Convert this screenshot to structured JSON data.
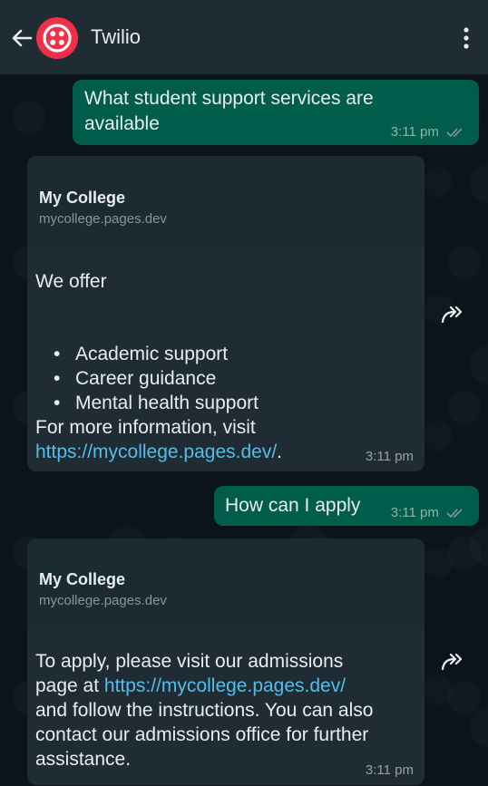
{
  "header": {
    "title": "Twilio",
    "icons": [
      "back-arrow-icon",
      "twilio-logo-icon",
      "more-vert-icon"
    ]
  },
  "messages": [
    {
      "direction": "out",
      "text_line1": "What student support services are",
      "text_line2": "available",
      "time": "3:11 pm"
    },
    {
      "direction": "in",
      "sender": "My College",
      "domain": "mycollege.pages.dev",
      "intro": "We offer",
      "list": [
        "Academic support",
        "Career guidance",
        "Mental health support"
      ],
      "more_info": "For more information, visit",
      "link": "https://mycollege.pages.dev/",
      "link_suffix": ".",
      "time": "3:11 pm"
    },
    {
      "direction": "out",
      "text": "How can I apply",
      "time": "3:11 pm"
    },
    {
      "direction": "in",
      "sender": "My College",
      "domain": "mycollege.pages.dev",
      "line1": "To apply, please visit our admissions",
      "line2_prefix": "page at ",
      "link": "https://mycollege.pages.dev/",
      "line3": "and follow the instructions. You can also",
      "line4": "contact our admissions office for further",
      "line5": "assistance.",
      "time": "3:11 pm"
    }
  ],
  "colors": {
    "header_bg": "#1f2c34",
    "chat_bg": "#0b141a",
    "outgoing_bubble": "#005c4b",
    "incoming_bubble": "#1f2c34",
    "link": "#53bdeb",
    "ticks": "#8696a0",
    "twilio_red": "#f22f46"
  }
}
